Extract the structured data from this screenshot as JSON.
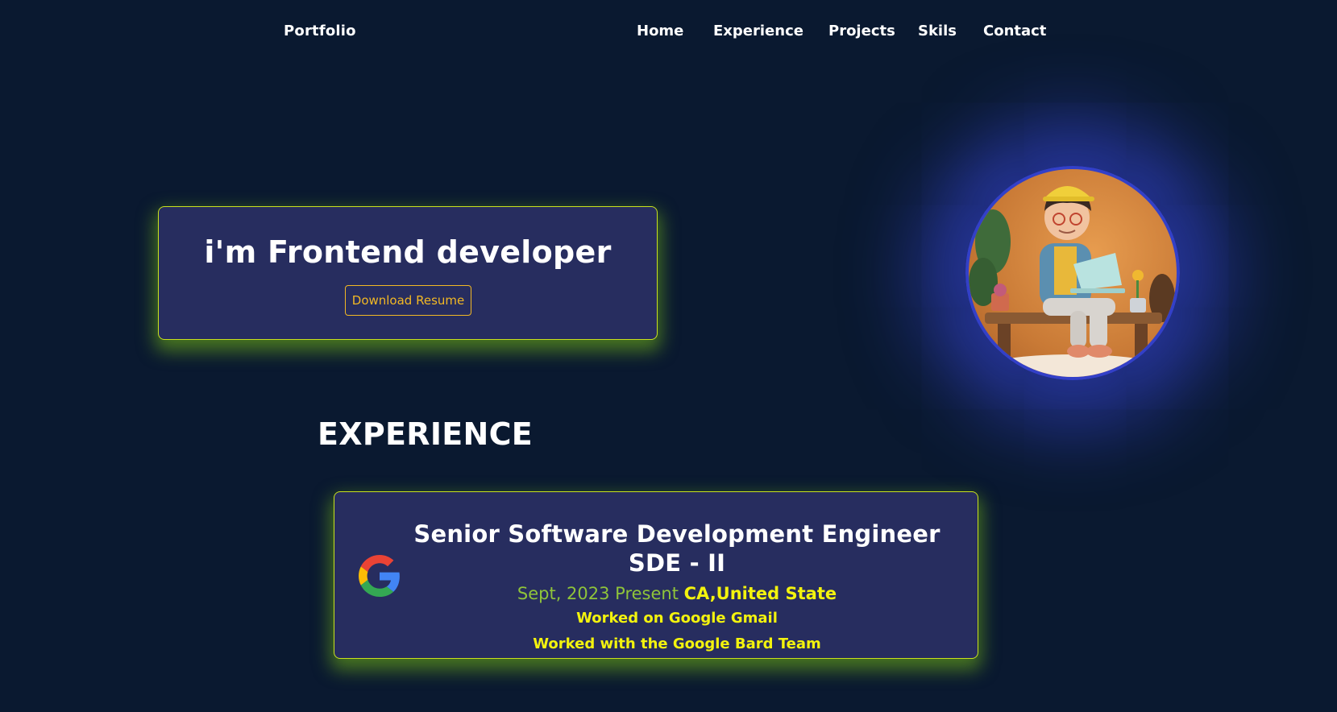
{
  "nav": {
    "brand": "Portfolio",
    "links": [
      "Home",
      "Experience",
      "Projects",
      "Skils",
      "Contact"
    ]
  },
  "hero": {
    "title": "i'm Frontend developer",
    "button_label": "Download Resume"
  },
  "experience": {
    "section_title": "EXPERIENCE",
    "items": [
      {
        "company_icon": "google-logo-icon",
        "role": "Senior Software Development Engineer SDE - II",
        "date": "Sept, 2023 Present",
        "location": "CA,United State",
        "details": [
          "Worked on Google Gmail",
          "Worked with the Google Bard Team"
        ]
      }
    ]
  },
  "colors": {
    "background": "#0a1930",
    "card": "#272d5f",
    "card_border": "#c9e21d",
    "accent_orange": "#f2b824",
    "accent_yellow": "#f3f30e",
    "accent_green": "#8fc43a",
    "avatar_ring": "#3340c8"
  },
  "avatar": {
    "icon": "developer-avatar-illustration"
  }
}
